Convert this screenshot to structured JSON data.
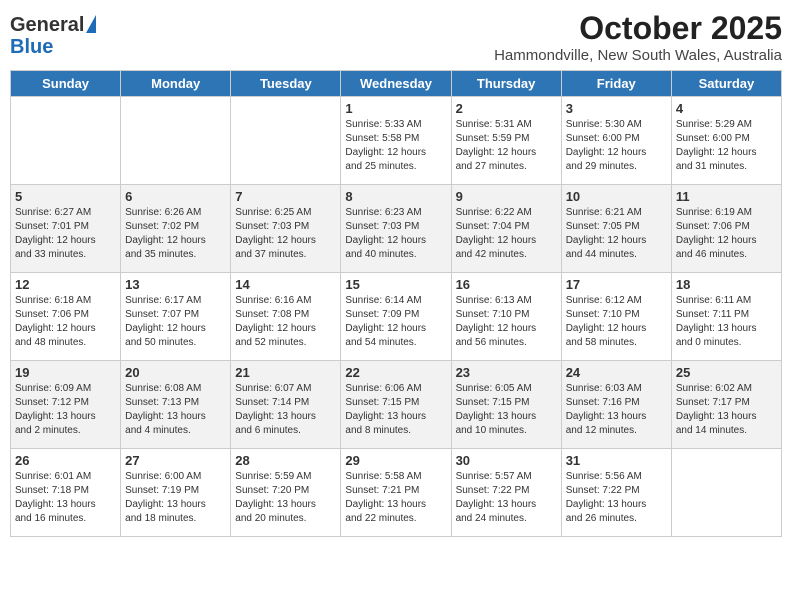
{
  "header": {
    "logo_line1": "General",
    "logo_line2": "Blue",
    "title": "October 2025",
    "subtitle": "Hammondville, New South Wales, Australia"
  },
  "days_of_week": [
    "Sunday",
    "Monday",
    "Tuesday",
    "Wednesday",
    "Thursday",
    "Friday",
    "Saturday"
  ],
  "weeks": [
    [
      {
        "day": "",
        "info": ""
      },
      {
        "day": "",
        "info": ""
      },
      {
        "day": "",
        "info": ""
      },
      {
        "day": "1",
        "info": "Sunrise: 5:33 AM\nSunset: 5:58 PM\nDaylight: 12 hours\nand 25 minutes."
      },
      {
        "day": "2",
        "info": "Sunrise: 5:31 AM\nSunset: 5:59 PM\nDaylight: 12 hours\nand 27 minutes."
      },
      {
        "day": "3",
        "info": "Sunrise: 5:30 AM\nSunset: 6:00 PM\nDaylight: 12 hours\nand 29 minutes."
      },
      {
        "day": "4",
        "info": "Sunrise: 5:29 AM\nSunset: 6:00 PM\nDaylight: 12 hours\nand 31 minutes."
      }
    ],
    [
      {
        "day": "5",
        "info": "Sunrise: 6:27 AM\nSunset: 7:01 PM\nDaylight: 12 hours\nand 33 minutes."
      },
      {
        "day": "6",
        "info": "Sunrise: 6:26 AM\nSunset: 7:02 PM\nDaylight: 12 hours\nand 35 minutes."
      },
      {
        "day": "7",
        "info": "Sunrise: 6:25 AM\nSunset: 7:03 PM\nDaylight: 12 hours\nand 37 minutes."
      },
      {
        "day": "8",
        "info": "Sunrise: 6:23 AM\nSunset: 7:03 PM\nDaylight: 12 hours\nand 40 minutes."
      },
      {
        "day": "9",
        "info": "Sunrise: 6:22 AM\nSunset: 7:04 PM\nDaylight: 12 hours\nand 42 minutes."
      },
      {
        "day": "10",
        "info": "Sunrise: 6:21 AM\nSunset: 7:05 PM\nDaylight: 12 hours\nand 44 minutes."
      },
      {
        "day": "11",
        "info": "Sunrise: 6:19 AM\nSunset: 7:06 PM\nDaylight: 12 hours\nand 46 minutes."
      }
    ],
    [
      {
        "day": "12",
        "info": "Sunrise: 6:18 AM\nSunset: 7:06 PM\nDaylight: 12 hours\nand 48 minutes."
      },
      {
        "day": "13",
        "info": "Sunrise: 6:17 AM\nSunset: 7:07 PM\nDaylight: 12 hours\nand 50 minutes."
      },
      {
        "day": "14",
        "info": "Sunrise: 6:16 AM\nSunset: 7:08 PM\nDaylight: 12 hours\nand 52 minutes."
      },
      {
        "day": "15",
        "info": "Sunrise: 6:14 AM\nSunset: 7:09 PM\nDaylight: 12 hours\nand 54 minutes."
      },
      {
        "day": "16",
        "info": "Sunrise: 6:13 AM\nSunset: 7:10 PM\nDaylight: 12 hours\nand 56 minutes."
      },
      {
        "day": "17",
        "info": "Sunrise: 6:12 AM\nSunset: 7:10 PM\nDaylight: 12 hours\nand 58 minutes."
      },
      {
        "day": "18",
        "info": "Sunrise: 6:11 AM\nSunset: 7:11 PM\nDaylight: 13 hours\nand 0 minutes."
      }
    ],
    [
      {
        "day": "19",
        "info": "Sunrise: 6:09 AM\nSunset: 7:12 PM\nDaylight: 13 hours\nand 2 minutes."
      },
      {
        "day": "20",
        "info": "Sunrise: 6:08 AM\nSunset: 7:13 PM\nDaylight: 13 hours\nand 4 minutes."
      },
      {
        "day": "21",
        "info": "Sunrise: 6:07 AM\nSunset: 7:14 PM\nDaylight: 13 hours\nand 6 minutes."
      },
      {
        "day": "22",
        "info": "Sunrise: 6:06 AM\nSunset: 7:15 PM\nDaylight: 13 hours\nand 8 minutes."
      },
      {
        "day": "23",
        "info": "Sunrise: 6:05 AM\nSunset: 7:15 PM\nDaylight: 13 hours\nand 10 minutes."
      },
      {
        "day": "24",
        "info": "Sunrise: 6:03 AM\nSunset: 7:16 PM\nDaylight: 13 hours\nand 12 minutes."
      },
      {
        "day": "25",
        "info": "Sunrise: 6:02 AM\nSunset: 7:17 PM\nDaylight: 13 hours\nand 14 minutes."
      }
    ],
    [
      {
        "day": "26",
        "info": "Sunrise: 6:01 AM\nSunset: 7:18 PM\nDaylight: 13 hours\nand 16 minutes."
      },
      {
        "day": "27",
        "info": "Sunrise: 6:00 AM\nSunset: 7:19 PM\nDaylight: 13 hours\nand 18 minutes."
      },
      {
        "day": "28",
        "info": "Sunrise: 5:59 AM\nSunset: 7:20 PM\nDaylight: 13 hours\nand 20 minutes."
      },
      {
        "day": "29",
        "info": "Sunrise: 5:58 AM\nSunset: 7:21 PM\nDaylight: 13 hours\nand 22 minutes."
      },
      {
        "day": "30",
        "info": "Sunrise: 5:57 AM\nSunset: 7:22 PM\nDaylight: 13 hours\nand 24 minutes."
      },
      {
        "day": "31",
        "info": "Sunrise: 5:56 AM\nSunset: 7:22 PM\nDaylight: 13 hours\nand 26 minutes."
      },
      {
        "day": "",
        "info": ""
      }
    ]
  ]
}
